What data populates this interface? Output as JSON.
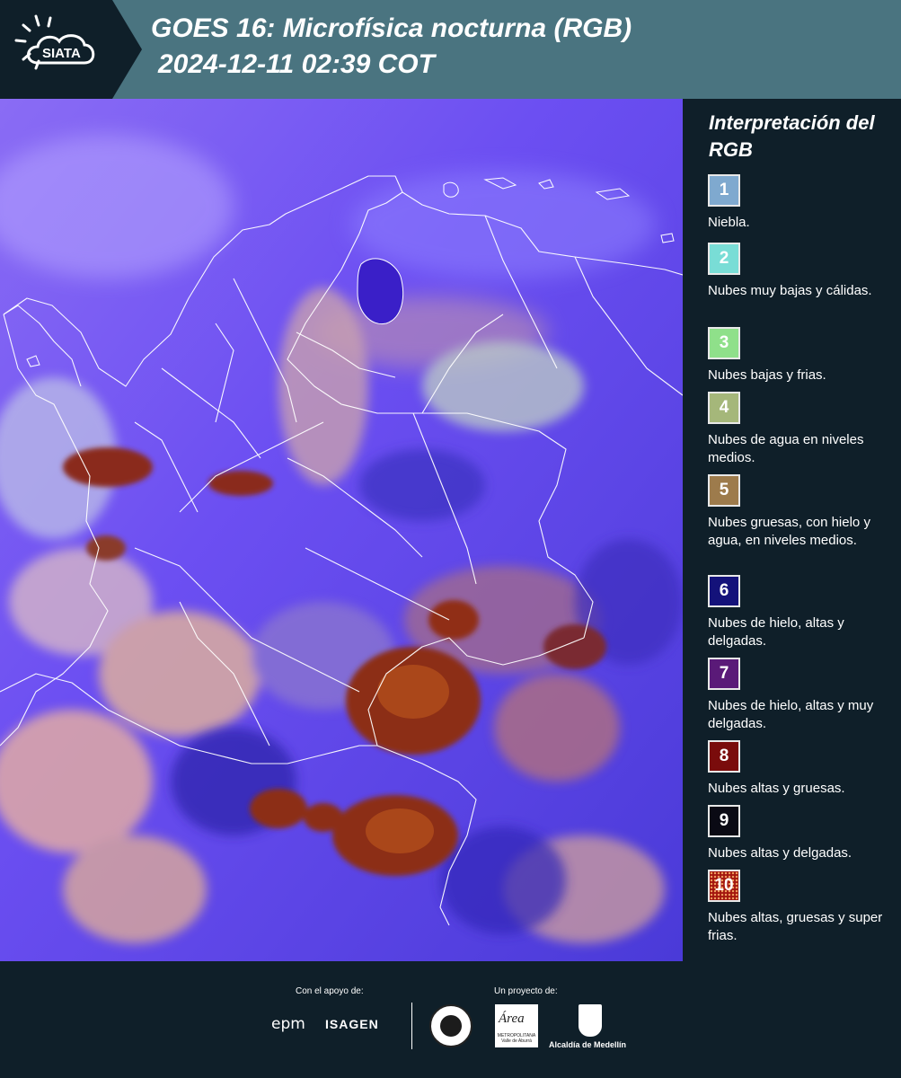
{
  "header": {
    "logo_text": "SIATA",
    "title": "GOES 16: Microfísica nocturna (RGB)",
    "subtitle": "2024-12-11 02:39 COT"
  },
  "legend": {
    "title": "Interpretación del RGB",
    "items": [
      {
        "number": "1",
        "text": "Niebla.",
        "color": "#7fa9cf"
      },
      {
        "number": "2",
        "text": "Nubes muy bajas y cálidas.",
        "color": "#79ddd6"
      },
      {
        "number": "3",
        "text": "Nubes bajas y frias.",
        "color": "#8fe08a"
      },
      {
        "number": "4",
        "text": "Nubes de agua en niveles medios.",
        "color": "#a5b77a"
      },
      {
        "number": "5",
        "text": "Nubes gruesas, con hielo y agua, en niveles medios.",
        "color": "#9d7b4c"
      },
      {
        "number": "6",
        "text": "Nubes de hielo, altas y delgadas.",
        "color": "#14127a"
      },
      {
        "number": "7",
        "text": "Nubes de hielo, altas y muy delgadas.",
        "color": "#5a1a78"
      },
      {
        "number": "8",
        "text": "Nubes altas y gruesas.",
        "color": "#7a0c0c"
      },
      {
        "number": "9",
        "text": "Nubes altas y delgadas.",
        "color": "#0a0a14"
      },
      {
        "number": "10",
        "text": "Nubes altas, gruesas y super frias.",
        "color": "#a3160f"
      }
    ]
  },
  "footer": {
    "support_label": "Con el apoyo de:",
    "project_label": "Un proyecto de:",
    "epm": "epm",
    "isagen": "ISAGEN",
    "area_logo": "Área",
    "area_sub": "METROPOLITANA Valle de Aburrá",
    "alcaldia": "Alcaldía de Medellín"
  }
}
